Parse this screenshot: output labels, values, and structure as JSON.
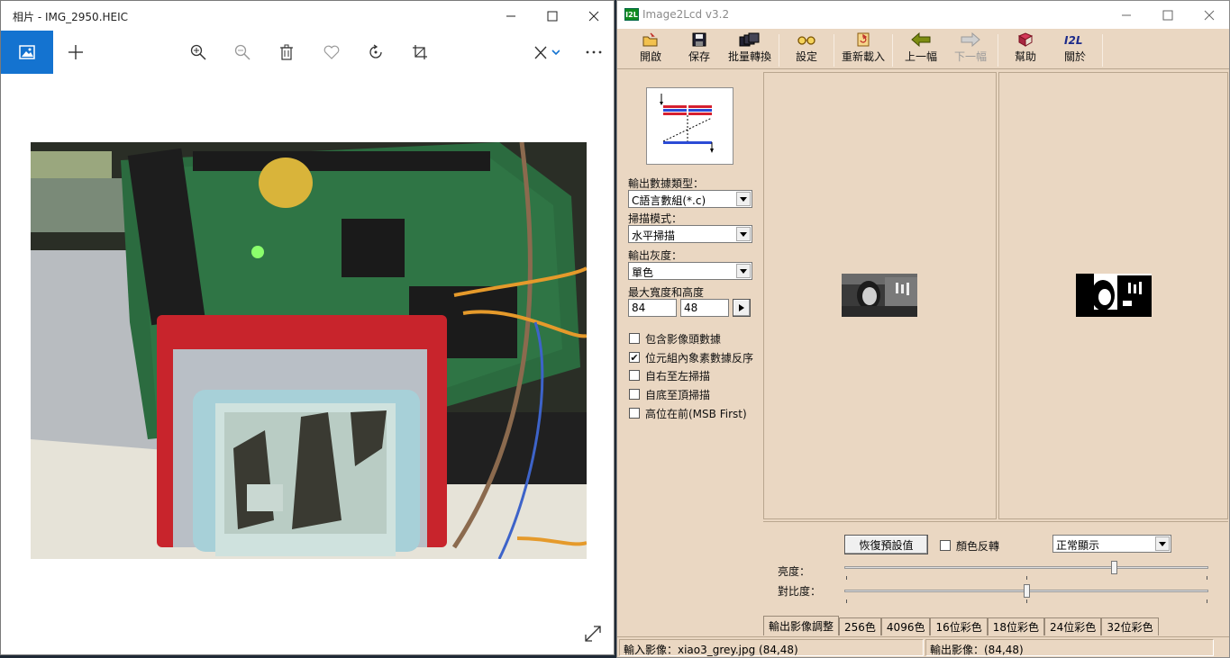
{
  "photos": {
    "title": "相片 - IMG_2950.HEIC",
    "toolbar_icons": [
      "picture-icon",
      "add-icon",
      "zoom-in-icon",
      "zoom-out-icon",
      "trash-icon",
      "heart-icon",
      "rotate-icon",
      "crop-icon",
      "edit-icon",
      "more-icon"
    ]
  },
  "lcd": {
    "title": "Image2Lcd v3.2",
    "toolbar": {
      "open": "開啟",
      "save": "保存",
      "batch": "批量轉換",
      "settings": "設定",
      "reload": "重新載入",
      "prev": "上一幅",
      "next": "下一幅",
      "help": "幫助",
      "about": "關於"
    },
    "form": {
      "output_type_label": "輸出數據類型：",
      "output_type_value": "C語言數組(*.c)",
      "scan_mode_label": "掃描模式：",
      "scan_mode_value": "水平掃描",
      "grey_label": "輸出灰度：",
      "grey_value": "單色",
      "max_size_label": "最大寬度和高度",
      "width": "84",
      "height": "48"
    },
    "options": [
      {
        "label": "包含影像頭數據",
        "checked": false
      },
      {
        "label": "位元組內象素數據反序",
        "checked": true
      },
      {
        "label": "自右至左掃描",
        "checked": false
      },
      {
        "label": "自底至頂掃描",
        "checked": false
      },
      {
        "label": "高位在前(MSB First)",
        "checked": false
      }
    ],
    "adjust": {
      "reset": "恢復預設值",
      "invert_label": "顏色反轉",
      "display_mode": "正常顯示",
      "brightness_label": "亮度：",
      "contrast_label": "對比度：",
      "brightness": 0.74,
      "contrast": 0.5
    },
    "tabs": [
      "輸出影像調整",
      "256色",
      "4096色",
      "16位彩色",
      "18位彩色",
      "24位彩色",
      "32位彩色"
    ],
    "status": {
      "input": "輸入影像：xiao3_grey.jpg (84,48)",
      "output": "輸出影像：(84,48)"
    }
  }
}
